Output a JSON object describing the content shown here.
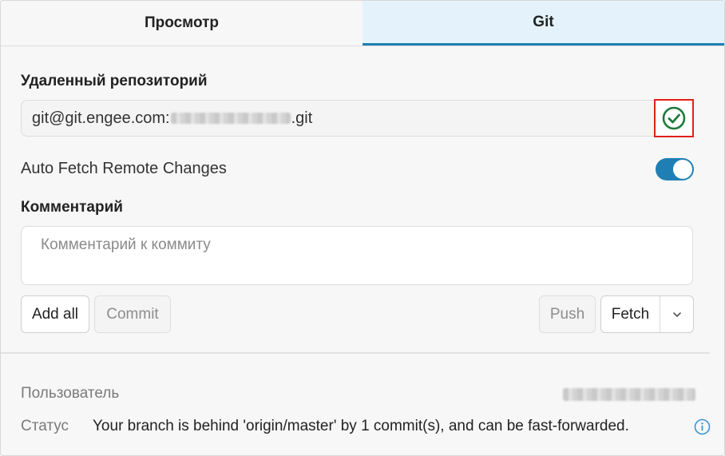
{
  "tabs": [
    {
      "label": "Просмотр",
      "active": false
    },
    {
      "label": "Git",
      "active": true
    }
  ],
  "remote": {
    "label": "Удаленный репозиторий",
    "value_prefix": "git@git.engee.com:",
    "value_suffix": ".git",
    "status_icon": "check-circle-icon"
  },
  "auto_fetch": {
    "label": "Auto Fetch Remote Changes",
    "enabled": true
  },
  "comment": {
    "label": "Комментарий",
    "placeholder": "Комментарий к коммиту"
  },
  "actions": {
    "add_all": "Add all",
    "commit": "Commit",
    "push": "Push",
    "fetch": "Fetch"
  },
  "info": {
    "user_label": "Пользователь",
    "status_label": "Статус",
    "status_text": "Your branch is behind 'origin/master' by 1 commit(s), and can be fast-forwarded."
  },
  "colors": {
    "accent": "#1f7fb4",
    "success": "#1e7a3c",
    "highlight": "#e0201a"
  }
}
